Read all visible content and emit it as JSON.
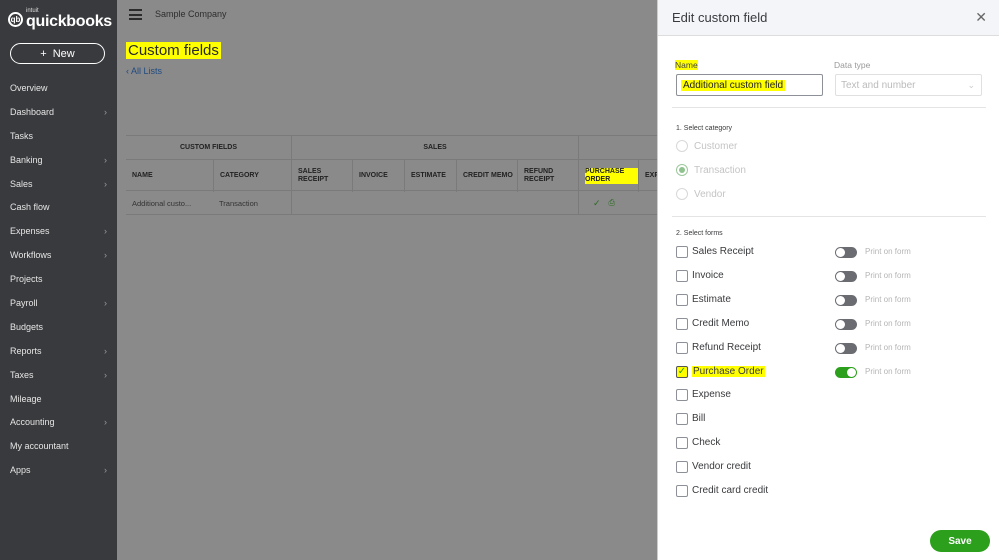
{
  "sidebar": {
    "logo_small": "intuit",
    "logo_big": "quickbooks",
    "new_label": "New",
    "items": [
      {
        "label": "Overview",
        "chevron": false
      },
      {
        "label": "Dashboard",
        "chevron": true
      },
      {
        "label": "Tasks",
        "chevron": false
      },
      {
        "label": "Banking",
        "chevron": true
      },
      {
        "label": "Sales",
        "chevron": true
      },
      {
        "label": "Cash flow",
        "chevron": false
      },
      {
        "label": "Expenses",
        "chevron": true
      },
      {
        "label": "Workflows",
        "chevron": true
      },
      {
        "label": "Projects",
        "chevron": false
      },
      {
        "label": "Payroll",
        "chevron": true
      },
      {
        "label": "Budgets",
        "chevron": false
      },
      {
        "label": "Reports",
        "chevron": true
      },
      {
        "label": "Taxes",
        "chevron": true
      },
      {
        "label": "Mileage",
        "chevron": false
      },
      {
        "label": "Accounting",
        "chevron": true
      },
      {
        "label": "My accountant",
        "chevron": false
      },
      {
        "label": "Apps",
        "chevron": true
      }
    ]
  },
  "header": {
    "company": "Sample Company"
  },
  "main": {
    "title": "Custom fields",
    "back_link": "All Lists",
    "table": {
      "groups": [
        "CUSTOM FIELDS",
        "SALES"
      ],
      "columns": [
        "NAME",
        "CATEGORY",
        "SALES RECEIPT",
        "INVOICE",
        "ESTIMATE",
        "CREDIT MEMO",
        "REFUND RECEIPT",
        "PURCHASE ORDER",
        "EXP"
      ],
      "rows": [
        {
          "name": "Additional custo...",
          "category": "Transaction"
        }
      ]
    }
  },
  "panel": {
    "title": "Edit custom field",
    "name_label": "Name",
    "name_value": "Additional custom field",
    "type_label": "Data type",
    "type_value": "Text and number",
    "category_section": "1. Select category",
    "categories": [
      {
        "label": "Customer",
        "selected": false
      },
      {
        "label": "Transaction",
        "selected": true
      },
      {
        "label": "Vendor",
        "selected": false
      }
    ],
    "forms_section": "2. Select forms",
    "print_label": "Print on form",
    "forms": [
      {
        "label": "Sales Receipt",
        "checked": false,
        "print_toggle": true,
        "print_on": false
      },
      {
        "label": "Invoice",
        "checked": false,
        "print_toggle": true,
        "print_on": false
      },
      {
        "label": "Estimate",
        "checked": false,
        "print_toggle": true,
        "print_on": false
      },
      {
        "label": "Credit Memo",
        "checked": false,
        "print_toggle": true,
        "print_on": false
      },
      {
        "label": "Refund Receipt",
        "checked": false,
        "print_toggle": true,
        "print_on": false
      },
      {
        "label": "Purchase Order",
        "checked": true,
        "print_toggle": true,
        "print_on": true
      },
      {
        "label": "Expense",
        "checked": false,
        "print_toggle": false
      },
      {
        "label": "Bill",
        "checked": false,
        "print_toggle": false
      },
      {
        "label": "Check",
        "checked": false,
        "print_toggle": false
      },
      {
        "label": "Vendor credit",
        "checked": false,
        "print_toggle": false
      },
      {
        "label": "Credit card credit",
        "checked": false,
        "print_toggle": false
      }
    ],
    "save_label": "Save"
  },
  "colors": {
    "sidebar_bg": "#393a3d",
    "accent_green": "#2ca01c",
    "highlight": "#ffff00",
    "overlay": "#8a8a8a"
  }
}
